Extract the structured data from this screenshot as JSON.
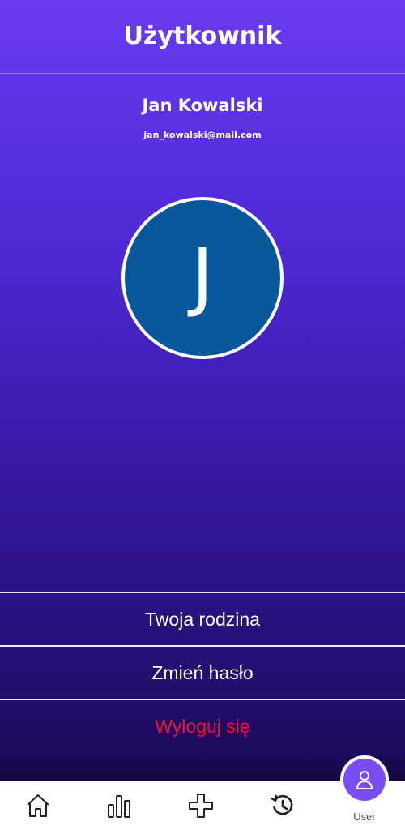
{
  "header": {
    "title": "Użytkownik"
  },
  "profile": {
    "name": "Jan Kowalski",
    "email": "jan_kowalski@mail.com",
    "avatar_initial": "J",
    "avatar_color": "#07589a"
  },
  "menu": {
    "family": "Twoja rodzina",
    "change_password": "Zmień hasło",
    "logout": "Wyloguj się"
  },
  "colors": {
    "logout_text": "#e8143a",
    "accent": "#7a4cf3"
  },
  "bottom_nav": {
    "items": [
      {
        "icon": "home-icon"
      },
      {
        "icon": "bar-chart-icon"
      },
      {
        "icon": "plus-icon"
      },
      {
        "icon": "history-icon"
      }
    ],
    "active": {
      "icon": "user-icon",
      "label": "User"
    }
  }
}
